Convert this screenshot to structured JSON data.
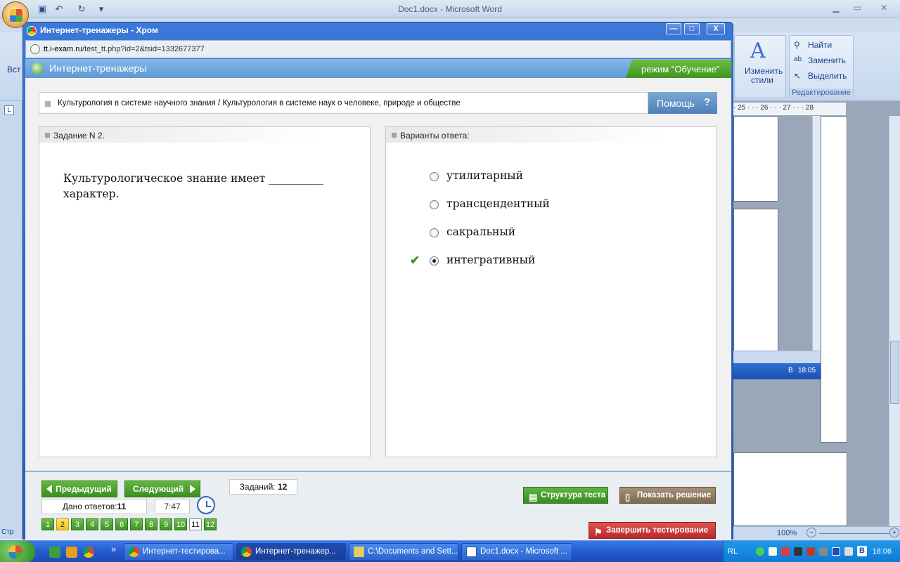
{
  "word": {
    "title": "Doc1.docx - Microsoft Word",
    "ribbon_left_fragment": "Вст",
    "styles_label": "Изменить стили",
    "styles_arrow": "▾",
    "find_label": "Найти",
    "replace_label": "Заменить",
    "select_label": "Выделить",
    "editing_group": "Редактирование",
    "ruler_marks": "· 25 · · · 26 · · · 27 · · · 28",
    "status_left": "Стр",
    "zoom": "100%",
    "inner_time": "18:05",
    "inner_b": "B"
  },
  "chrome": {
    "title": "Интернет-тренажеры - Хром",
    "url_host": "tt.i-exam.ru",
    "url_path": "/test_tt.php?id=2&tsid=1332677377",
    "min": "—",
    "max": "□",
    "close": "X"
  },
  "site": {
    "name": "Интернет-тренажеры",
    "mode": "режим \"Обучение\"",
    "breadcrumb": "Культурология в системе научного знания / Культурология в системе наук о человеке, природе и обществе",
    "help": "Помощь",
    "help_icon": "?",
    "question_header": "Задание N 2.",
    "question_text": "Культурологическое знание имеет __________ характер.",
    "answers_header": "Варианты ответа:",
    "options": [
      {
        "text": "утилитарный",
        "selected": false
      },
      {
        "text": "трансцендентный",
        "selected": false
      },
      {
        "text": "сакральный",
        "selected": false
      },
      {
        "text": "интегративный",
        "selected": true
      }
    ],
    "prev": "Предыдущий",
    "next": "Следующий",
    "tasks_label": "Заданий:",
    "tasks_count": "12",
    "answered_label": "Дано ответов:",
    "answered_count": "11",
    "timer": "7:47",
    "pages": [
      "1",
      "2",
      "3",
      "4",
      "5",
      "6",
      "7",
      "8",
      "9",
      "10",
      "11",
      "12"
    ],
    "answered_page": "2",
    "current_page": "11",
    "structure": "Структура теста",
    "solution": "Показать решение",
    "finish": "Завершить тестирование"
  },
  "taskbar": {
    "items": [
      "Интернет-тестирова...",
      "Интернет-тренажер...",
      "C:\\Documents and Sett...",
      "Doc1.docx - Microsoft ..."
    ],
    "chevron": "»",
    "lang": "RL",
    "b": "B",
    "time": "18:06"
  },
  "colors": {
    "accent_green": "#3a8f1f",
    "header_blue": "#5e98d6",
    "finish_red": "#b72a2a",
    "solution_brown": "#7d6a52"
  }
}
